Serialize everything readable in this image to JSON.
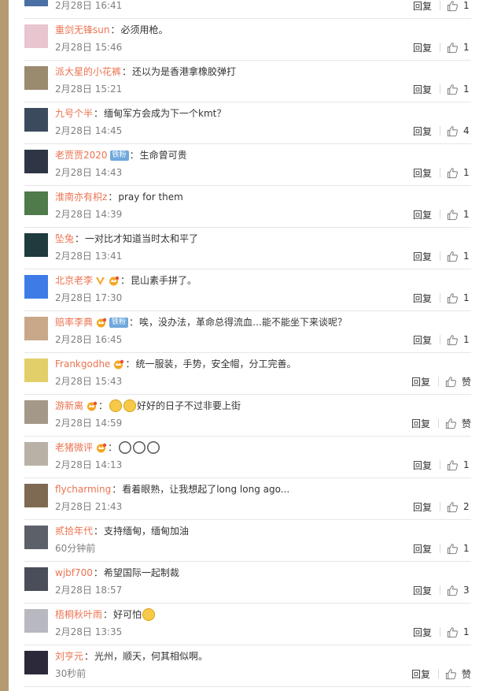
{
  "comments": [
    {
      "user": "",
      "content": "",
      "time": "2月28日 16:41",
      "likes": "1",
      "avatar_color": "#4a6fa5"
    },
    {
      "user": "重剑无锋sun",
      "content": "必须用枪。",
      "time": "2月28日 15:46",
      "likes": "1",
      "avatar_color": "#e8c5cf"
    },
    {
      "user": "派大星的小花裤",
      "content": "还以为是香港拿橡胶弹打",
      "time": "2月28日 15:21",
      "likes": "1",
      "avatar_color": "#9a8a6e"
    },
    {
      "user": "九号个半",
      "content": "缅甸军方会成为下一个kmt？",
      "time": "2月28日 14:45",
      "likes": "4",
      "avatar_color": "#3c4a5e"
    },
    {
      "user": "老贾贾2020",
      "badge_fan": "铁粉",
      "content": "生命曾可贵",
      "time": "2月28日 14:43",
      "likes": "1",
      "avatar_color": "#2e3646"
    },
    {
      "user": "淮南亦有枳z",
      "content": "pray for them",
      "time": "2月28日 14:39",
      "likes": "1",
      "avatar_color": "#4f7a4a"
    },
    {
      "user": "坠兔",
      "content": "一对比才知道当时太和平了",
      "time": "2月28日 13:41",
      "likes": "1",
      "avatar_color": "#1f3b3e"
    },
    {
      "user": "北京老李",
      "content": "昆山素手拼了。",
      "time": "2月28日 17:30",
      "likes": "1",
      "avatar_color": "#3e7be6"
    },
    {
      "user": "赔率李典",
      "badge_fan": "铁粉",
      "content": "唉，没办法，革命总得流血…能不能坐下来谈呢？",
      "time": "2月28日 16:45",
      "likes": "1",
      "avatar_color": "#c9a88a"
    },
    {
      "user": "Frankgodhe",
      "content": "统一服装，手势，安全帽，分工完善。",
      "time": "2月28日 15:43",
      "likes": "赞",
      "avatar_color": "#e2cf6a"
    },
    {
      "user": "游新离",
      "content": "好好的日子不过非要上街",
      "time": "2月28日 14:59",
      "likes": "赞",
      "avatar_color": "#a49888"
    },
    {
      "user": "老猪微评",
      "content": "",
      "time": "2月28日 14:13",
      "likes": "1",
      "avatar_color": "#b9b1a6"
    },
    {
      "user": "flycharming",
      "content": "看着眼熟，让我想起了long long ago...",
      "time": "2月28日 21:43",
      "likes": "2",
      "avatar_color": "#7e6a52"
    },
    {
      "user": "贰拾年代",
      "content": "支持缅甸，缅甸加油",
      "time": "60分钟前",
      "likes": "1",
      "avatar_color": "#5c6068"
    },
    {
      "user": "wjbf700",
      "content": "希望国际一起制裁",
      "time": "2月28日 18:57",
      "likes": "3",
      "avatar_color": "#4a4e5a"
    },
    {
      "user": "梧桐秋叶雨",
      "content": "好可怕",
      "time": "2月28日 13:35",
      "likes": "1",
      "avatar_color": "#b8b8c0"
    },
    {
      "user": "刘亨元",
      "content": "光州，顺天，何其相似啊。",
      "time": "30秒前",
      "likes": "赞",
      "avatar_color": "#2c2a3a"
    }
  ],
  "labels": {
    "reply": "回复",
    "colon": "："
  },
  "colors": {
    "username": "#eb7350",
    "time": "#808080",
    "fan_badge": "#6fa8dc",
    "crown": "#f5a623",
    "left_strip": "#b59a72"
  }
}
